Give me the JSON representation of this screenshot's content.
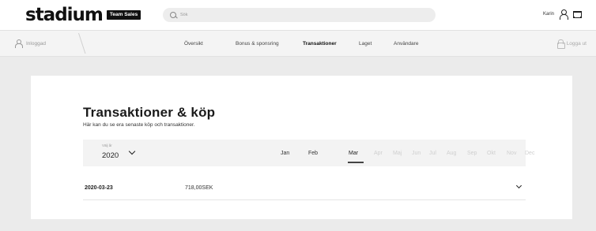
{
  "header": {
    "brand": "stadium",
    "badge": "Team Sales",
    "search_placeholder": "Sök",
    "user_name": "Karin"
  },
  "subnav": {
    "breadcrumb": "Inloggad",
    "links": [
      {
        "label": "Översikt",
        "active": false
      },
      {
        "label": "Bonus & sponsring",
        "active": false
      },
      {
        "label": "Transaktioner",
        "active": true
      },
      {
        "label": "Laget",
        "active": false
      },
      {
        "label": "Användare",
        "active": false
      }
    ],
    "logout": "Logga ut"
  },
  "main": {
    "title": "Transaktioner & köp",
    "subtitle": "Här kan du se era senaste köp och transaktioner.",
    "year_select": {
      "label": "Välj år",
      "value": "2020"
    },
    "months": [
      {
        "label": "Jan",
        "enabled": true,
        "selected": false
      },
      {
        "label": "Feb",
        "enabled": true,
        "selected": false
      },
      {
        "label": "Mar",
        "enabled": true,
        "selected": true
      },
      {
        "label": "Apr",
        "enabled": false,
        "selected": false
      },
      {
        "label": "Maj",
        "enabled": false,
        "selected": false
      },
      {
        "label": "Jun",
        "enabled": false,
        "selected": false
      },
      {
        "label": "Jul",
        "enabled": false,
        "selected": false
      },
      {
        "label": "Aug",
        "enabled": false,
        "selected": false
      },
      {
        "label": "Sep",
        "enabled": false,
        "selected": false
      },
      {
        "label": "Okt",
        "enabled": false,
        "selected": false
      },
      {
        "label": "Nov",
        "enabled": false,
        "selected": false
      },
      {
        "label": "Dec",
        "enabled": false,
        "selected": false
      }
    ],
    "transactions": [
      {
        "date": "2020-03-23",
        "amount": "718,00SEK"
      }
    ]
  },
  "icons": [
    "search-icon",
    "user-icon",
    "cart-icon",
    "lock-icon",
    "chevron-down-icon"
  ]
}
